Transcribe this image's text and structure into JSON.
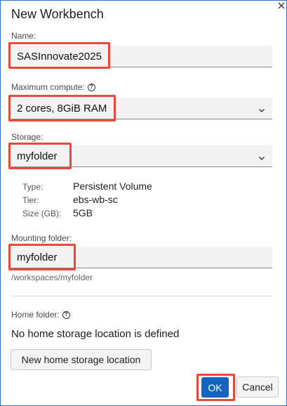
{
  "dialog": {
    "title": "New Workbench"
  },
  "name": {
    "label": "Name:",
    "value": "SASInnovate2025"
  },
  "compute": {
    "label": "Maximum compute:",
    "value": "2 cores, 8GiB RAM"
  },
  "storage": {
    "label": "Storage:",
    "value": "myfolder",
    "details": [
      {
        "key": "Type:",
        "value": "Persistent Volume"
      },
      {
        "key": "Tier:",
        "value": "ebs-wb-sc"
      },
      {
        "key": "Size (GB):",
        "value": "5GB"
      }
    ]
  },
  "mounting": {
    "label": "Mounting folder:",
    "value": "myfolder",
    "path": "/workspaces/myfolder"
  },
  "home": {
    "label": "Home folder:",
    "message": "No home storage location is defined",
    "new_button": "New home storage location"
  },
  "actions": {
    "ok": "OK",
    "cancel": "Cancel"
  },
  "colors": {
    "accent": "#1565c0",
    "highlight": "#e8483b",
    "dialog_border": "#2f6fd6"
  },
  "icons": {
    "info": "info-icon",
    "chevron": "chevron-down-icon",
    "close": "close-icon"
  }
}
